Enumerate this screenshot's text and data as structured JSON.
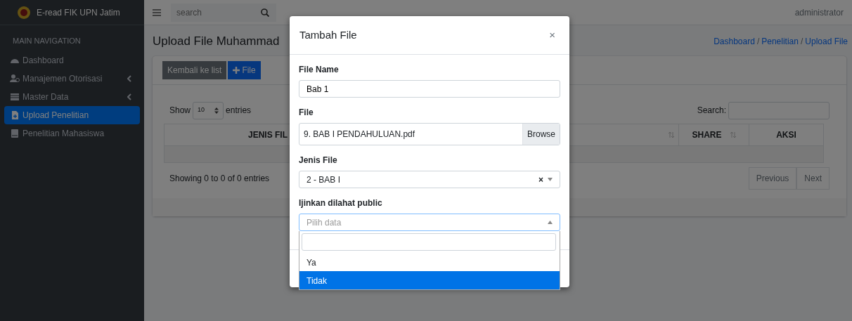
{
  "brand": {
    "title": "E-read FIK UPN Jatim"
  },
  "topbar": {
    "search_placeholder": "search",
    "user": "administrator"
  },
  "sidebar": {
    "header": "MAIN NAVIGATION",
    "items": [
      {
        "label": "Dashboard",
        "submenu": false,
        "selected": false
      },
      {
        "label": "Manajemen Otorisasi",
        "submenu": true,
        "selected": false
      },
      {
        "label": "Master Data",
        "submenu": true,
        "selected": false
      },
      {
        "label": "Upload Penelitian",
        "submenu": false,
        "selected": true
      },
      {
        "label": "Penelitian Mahasiswa",
        "submenu": false,
        "selected": false
      }
    ]
  },
  "page": {
    "title": "Upload File Muhammad",
    "breadcrumb": [
      "Dashboard",
      "Penelitian",
      "Upload File"
    ],
    "breadcrumb_separators": [
      "/",
      "/"
    ]
  },
  "card": {
    "back_button": "Kembali ke list",
    "add_button": "File",
    "show_label": "Show",
    "page_size": "10",
    "entries_label": "entries",
    "search_label": "Search:",
    "columns": [
      {
        "label": "JENIS FIL",
        "sortable": false
      },
      {
        "sortable": true
      },
      {
        "label": "SHARE",
        "sortable": true
      },
      {
        "label": "AKSI",
        "sortable": false
      }
    ],
    "info": "Showing 0 to 0 of 0 entries",
    "pagination": [
      "Previous",
      "Next"
    ]
  },
  "modal": {
    "title": "Tambah File",
    "close": "×",
    "fields": [
      {
        "kind": "text",
        "label": "File Name",
        "value": "Bab 1"
      },
      {
        "kind": "file",
        "label": "File",
        "value": "9. BAB I PENDAHULUAN.pdf",
        "button": "Browse"
      },
      {
        "kind": "select",
        "label": "Jenis File",
        "value": "2 - BAB I",
        "clear": "×",
        "expanded": false
      },
      {
        "kind": "select",
        "label": "Ijinkan dilahat public",
        "placeholder": "Pilih data",
        "expanded": true,
        "options": [
          {
            "label": "Ya",
            "selected": false
          },
          {
            "label": "Tidak",
            "selected": true
          }
        ]
      }
    ]
  }
}
